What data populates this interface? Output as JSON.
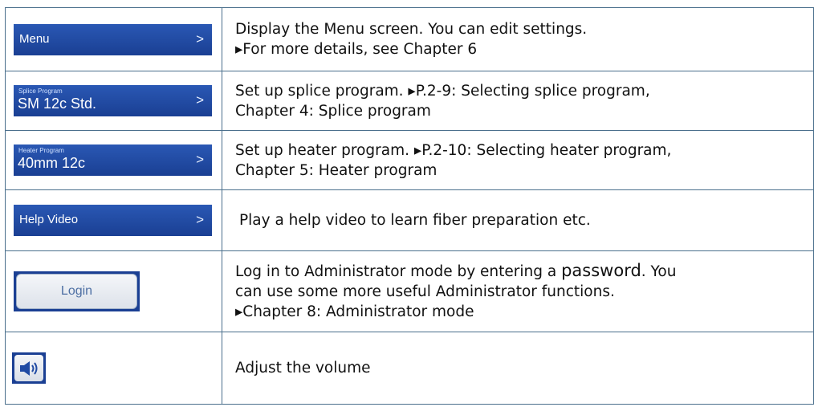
{
  "rows": [
    {
      "button": {
        "label": "Menu"
      },
      "description": {
        "line1": "Display the Menu screen. You can edit settings.",
        "line2": "▸For more details, see Chapter 6"
      }
    },
    {
      "button": {
        "caption": "Splice Program",
        "value": "SM 12c Std."
      },
      "description": {
        "line1": "Set up splice program. ▸P.2-9: Selecting splice program,",
        "line2": "Chapter 4: Splice program"
      }
    },
    {
      "button": {
        "caption": "Heater Program",
        "value": "40mm 12c"
      },
      "description": {
        "line1": "Set up heater program. ▸P.2-10: Selecting heater program,",
        "line2": "Chapter 5: Heater program"
      }
    },
    {
      "button": {
        "label": "Help Video"
      },
      "description": {
        "line1": "Play a help video to learn fiber preparation etc."
      }
    },
    {
      "button": {
        "label": "Login"
      },
      "description": {
        "line1_a": "Log in to Administrator mode by entering a ",
        "line1_b": "password",
        "line1_c": ". You",
        "line2": "can use some more useful Administrator functions.",
        "line3": "▸Chapter 8: Administrator mode"
      }
    },
    {
      "button": {
        "icon": "speaker-icon"
      },
      "description": {
        "line1": "Adjust the volume"
      }
    }
  ],
  "colors": {
    "button_blue": "#1f4aa3",
    "border": "#4a6f8c"
  }
}
